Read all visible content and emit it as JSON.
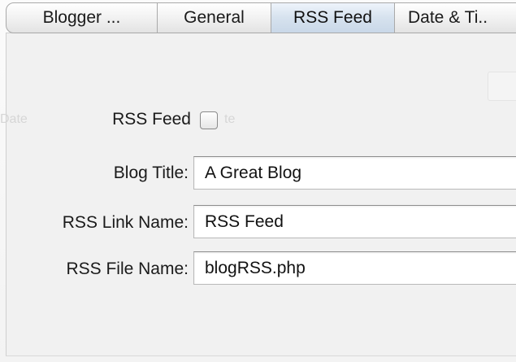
{
  "tabs": [
    {
      "label": "Blogger ...",
      "selected": false
    },
    {
      "label": "General",
      "selected": false
    },
    {
      "label": "RSS Feed",
      "selected": true
    },
    {
      "label": "Date & Ti..",
      "selected": false
    }
  ],
  "ghost": {
    "left": "Date",
    "right": "te"
  },
  "form": {
    "rss_feed_label": "RSS Feed",
    "rss_feed_checked": false,
    "blog_title_label": "Blog Title:",
    "blog_title_value": "A Great Blog",
    "rss_link_name_label": "RSS Link Name:",
    "rss_link_name_value": "RSS Feed",
    "rss_file_name_label": "RSS File Name:",
    "rss_file_name_value": "blogRSS.php"
  },
  "colors": {
    "selected_tab": "#d6e2ee",
    "pane_background": "#f1f1f1"
  }
}
